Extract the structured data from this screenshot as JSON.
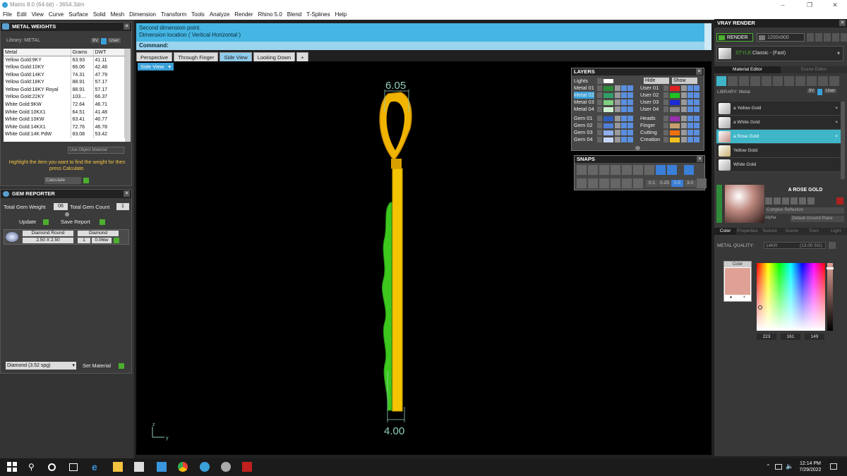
{
  "window": {
    "title": "Matrix 8.0 (64-bit) - 3654.3dm"
  },
  "menu": [
    "File",
    "Edit",
    "View",
    "Curve",
    "Surface",
    "Solid",
    "Mesh",
    "Dimension",
    "Transform",
    "Tools",
    "Analyze",
    "Render",
    "Rhino 5.0",
    "Blend",
    "T-Splines",
    "Help"
  ],
  "metal_weights": {
    "title": "METAL WEIGHTS",
    "library_label": "Library: METAL",
    "btn_9v": "9V",
    "btn_user": "User",
    "columns": [
      "Metal",
      "Grams",
      "DWT"
    ],
    "rows": [
      [
        "Yellow Gold:9KY",
        "63.93",
        "41.11"
      ],
      [
        "Yellow Gold:10KY",
        "66.06",
        "42.48"
      ],
      [
        "Yellow Gold:14KY",
        "74.31",
        "47.79"
      ],
      [
        "Yellow Gold:18KY",
        "88.91",
        "57.17"
      ],
      [
        "Yellow Gold:18KY Royal",
        "88.91",
        "57.17"
      ],
      [
        "Yellow Gold:22KY",
        "103....",
        "66.37"
      ],
      [
        "White Gold:9KW",
        "72.64",
        "46.71"
      ],
      [
        "White Gold:10KX1",
        "64.51",
        "41.48"
      ],
      [
        "White Gold:10KW",
        "63.41",
        "40.77"
      ],
      [
        "White Gold:14KX1",
        "72.76",
        "46.78"
      ],
      [
        "White Gold:14K PdW",
        "83.08",
        "53.42"
      ]
    ],
    "use_object_material": "Use Object Material",
    "hint": "Highlight the item you want to find the weight for then press Calculate.",
    "calculate": "Calculate"
  },
  "gem_reporter": {
    "title": "GEM REPORTER",
    "total_weight_label": "Total Gem Weight",
    "total_weight_value": "06",
    "total_count_label": "Total Gem Count",
    "total_count_value": "1",
    "update": "Update",
    "save_report": "Save Report",
    "gem_name": "Diamond Round",
    "gem_type": "Diamond",
    "gem_size": "2.50 X 2.50",
    "gem_qty": "1",
    "gem_ctw": "0.06tw",
    "material_select": "Diamond    (3.52 spg)",
    "set_material": "Set Material"
  },
  "command": {
    "line1": "Second dimension point.",
    "line2": "Dimension location ( Vertical  Horizontal )",
    "prompt": "Command:"
  },
  "view_tabs": [
    "Perspective",
    "Through Finger",
    "Side View",
    "Looking Down"
  ],
  "active_tab": "Side View",
  "viewport_label": "Side View",
  "dimensions": {
    "top": "6.05",
    "bottom": "4.00"
  },
  "axis": {
    "z": "z",
    "y": "y"
  },
  "layers": {
    "title": "LAYERS",
    "lights": "Lights",
    "hide": "Hide",
    "show": "Show",
    "left": [
      {
        "name": "Metal 01",
        "color": "#2e8b3a"
      },
      {
        "name": "Metal 02",
        "color": "#2f9e68"
      },
      {
        "name": "Metal 03",
        "color": "#7fd07f"
      },
      {
        "name": "Metal 04",
        "color": "#cfeecf"
      },
      {
        "name": "Gem 01",
        "color": "#2f5fbf"
      },
      {
        "name": "Gem 02",
        "color": "#4f7fd8"
      },
      {
        "name": "Gem 03",
        "color": "#8fb0ec"
      },
      {
        "name": "Gem 04",
        "color": "#c5d6f5"
      }
    ],
    "right": [
      {
        "name": "User 01",
        "color": "#e02020"
      },
      {
        "name": "User 02",
        "color": "#20c020"
      },
      {
        "name": "User 03",
        "color": "#1a2ad8"
      },
      {
        "name": "User 04",
        "color": "#888888"
      },
      {
        "name": "Heads",
        "color": "#9a30b0"
      },
      {
        "name": "Finger",
        "color": "#c8a070"
      },
      {
        "name": "Cutting",
        "color": "#f07010"
      },
      {
        "name": "Creation",
        "color": "#f0c020"
      }
    ]
  },
  "snaps": {
    "title": "SNAPS",
    "values": [
      "0.1",
      "0.25",
      "0.5",
      "3.0"
    ]
  },
  "vray": {
    "title": "VRAY RENDER",
    "render": "RENDER",
    "resolution": "1200x900",
    "style_label": "STYLE:",
    "style_value": "Classic - (Fast)",
    "tabs": [
      "Material Editor",
      "Scene Editor"
    ],
    "library_label": "LIBRARY: Metal",
    "materials": [
      "a Yellow Gold",
      "a White Gold",
      "a Rose Gold",
      "Yellow Gold",
      "White Gold"
    ],
    "selected_material": "A ROSE GOLD",
    "complex_reflection": "Complex Reflection",
    "alpha": "Alpha",
    "ground": "Default Ground Plane",
    "bottom_tabs": [
      "Color",
      "Properties",
      "Texture",
      "Scene",
      "Toon",
      "Light"
    ],
    "metal_quality_label": "METAL QUALITY:",
    "metal_quality_value": "14KR",
    "metal_quality_sg": "(13.00 SG)",
    "color_label": "Color",
    "swatch_color": "#dfa195",
    "rgb": [
      "223",
      "161",
      "149"
    ]
  },
  "taskbar": {
    "time": "12:14 PM",
    "date": "7/29/2022"
  }
}
